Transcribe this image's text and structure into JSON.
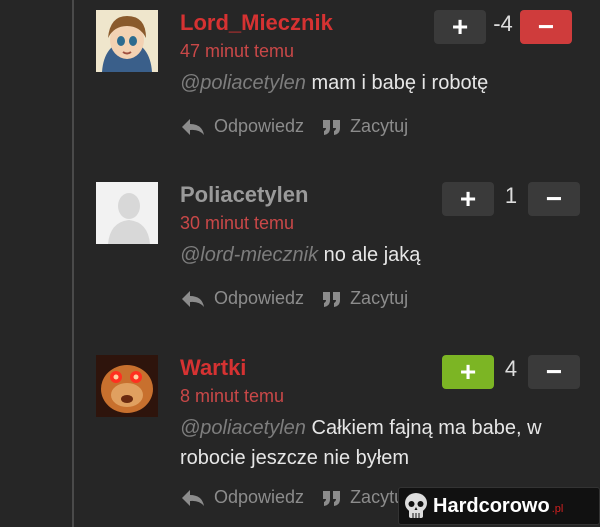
{
  "comments": [
    {
      "author": "Lord_Miecznik",
      "author_color": "#d63232",
      "time": "47 minut temu",
      "mention": "@poliacetylen",
      "text": "mam i babę i robotę",
      "score": "-4",
      "active_vote": "minus",
      "reply_label": "Odpowiedz",
      "quote_label": "Zacytuj"
    },
    {
      "author": "Poliacetylen",
      "author_color": "#9a9a9a",
      "time": "30 minut temu",
      "mention": "@lord-miecznik",
      "text": "no ale jaką",
      "score": "1",
      "active_vote": "none",
      "reply_label": "Odpowiedz",
      "quote_label": "Zacytuj"
    },
    {
      "author": "Wartki",
      "author_color": "#d63232",
      "time": "8 minut temu",
      "mention": "@poliacetylen",
      "text": "Całkiem fajną ma babe, w robocie jeszcze nie byłem",
      "score": "4",
      "active_vote": "plus",
      "reply_label": "Odpowiedz",
      "quote_label": "Zacytuj"
    }
  ],
  "vote": {
    "plus": "+",
    "minus": "−"
  },
  "watermark": {
    "name": "Hardcorowo",
    "tld": ".pl"
  },
  "colors": {
    "upvote_active": "#7cb524",
    "downvote_active": "#cf3c3c",
    "time": "#c94848"
  },
  "icons": {
    "reply": "reply-arrow-icon",
    "quote": "quote-icon",
    "watermark": "skull-icon"
  }
}
